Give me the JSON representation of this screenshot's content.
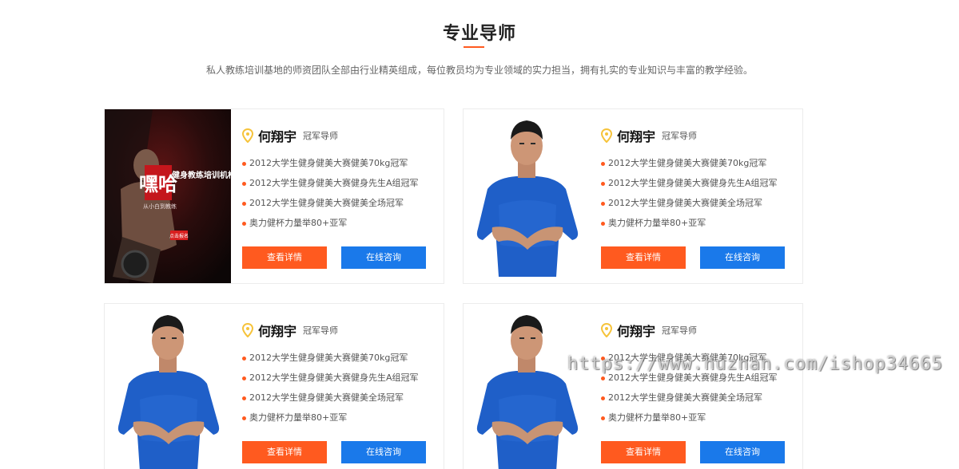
{
  "section": {
    "title": "专业导师",
    "description": "私人教练培训基地的师资团队全部由行业精英组成，每位教员均为专业领域的实力担当，拥有扎实的专业知识与丰富的教学经验。"
  },
  "colors": {
    "accent_orange": "#ff5a1f",
    "accent_blue": "#1a79ea",
    "pin_yellow": "#f6c33a"
  },
  "coaches": [
    {
      "photo": "gym-poster-image",
      "name": "何翔宇",
      "rank": "冠军导师",
      "awards": [
        "2012大学生健身健美大赛健美70kg冠军",
        "2012大学生健身健美大赛健身先生A组冠军",
        "2012大学生健身健美大赛健美全场冠军",
        "奥力健杯力量举80+亚军"
      ],
      "detail_label": "查看详情",
      "consult_label": "在线咨询"
    },
    {
      "photo": "coach-portrait-image",
      "name": "何翔宇",
      "rank": "冠军导师",
      "awards": [
        "2012大学生健身健美大赛健美70kg冠军",
        "2012大学生健身健美大赛健身先生A组冠军",
        "2012大学生健身健美大赛健美全场冠军",
        "奥力健杯力量举80+亚军"
      ],
      "detail_label": "查看详情",
      "consult_label": "在线咨询"
    },
    {
      "photo": "coach-portrait-image",
      "name": "何翔宇",
      "rank": "冠军导师",
      "awards": [
        "2012大学生健身健美大赛健美70kg冠军",
        "2012大学生健身健美大赛健身先生A组冠军",
        "2012大学生健身健美大赛健美全场冠军",
        "奥力健杯力量举80+亚军"
      ],
      "detail_label": "查看详情",
      "consult_label": "在线咨询"
    },
    {
      "photo": "coach-portrait-image",
      "name": "何翔宇",
      "rank": "冠军导师",
      "awards": [
        "2012大学生健身健美大赛健美70kg冠军",
        "2012大学生健身健美大赛健身先生A组冠军",
        "2012大学生健身健美大赛健美全场冠军",
        "奥力健杯力量举80+亚军"
      ],
      "detail_label": "查看详情",
      "consult_label": "在线咨询"
    }
  ],
  "watermark": "https://www.huzhan.com/ishop34665",
  "poster": {
    "headline": "嘿哈",
    "subtitle": "健身教练培训机构",
    "tagline": "从小白到教练",
    "button_label": "点击报名"
  }
}
